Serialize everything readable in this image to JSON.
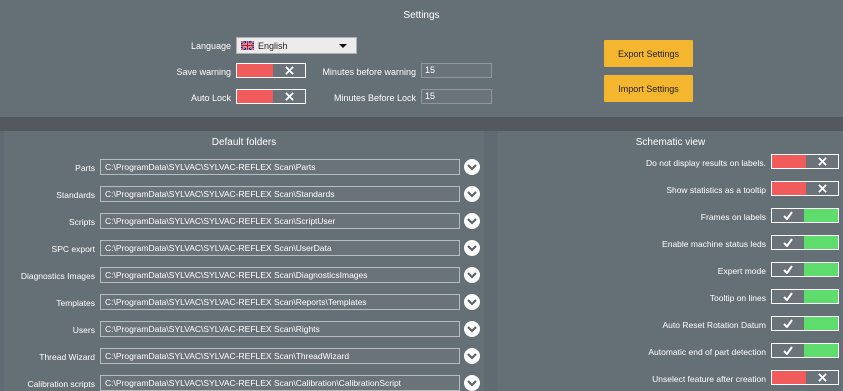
{
  "settings": {
    "title": "Settings",
    "language": {
      "label": "Language",
      "value": "English",
      "flag_icon": "uk-flag-icon"
    },
    "save_warning": {
      "label": "Save warning",
      "state": "off"
    },
    "auto_lock": {
      "label": "Auto Lock",
      "state": "off"
    },
    "minutes_warning": {
      "label": "Minutes before warning",
      "value": "15"
    },
    "minutes_lock": {
      "label": "Minutes Before Lock",
      "value": "15"
    },
    "export_label": "Export Settings",
    "import_label": "Import Settings"
  },
  "folders": {
    "title": "Default folders",
    "items": [
      {
        "label": "Parts",
        "path": "C:\\ProgramData\\SYLVAC\\SYLVAC-REFLEX Scan\\Parts"
      },
      {
        "label": "Standards",
        "path": "C:\\ProgramData\\SYLVAC\\SYLVAC-REFLEX Scan\\Standards"
      },
      {
        "label": "Scripts",
        "path": "C:\\ProgramData\\SYLVAC\\SYLVAC-REFLEX Scan\\ScriptUser"
      },
      {
        "label": "SPC export",
        "path": "C:\\ProgramData\\SYLVAC\\SYLVAC-REFLEX Scan\\UserData"
      },
      {
        "label": "Diagnostics Images",
        "path": "C:\\ProgramData\\SYLVAC\\SYLVAC-REFLEX Scan\\DiagnosticsImages"
      },
      {
        "label": "Templates",
        "path": "C:\\ProgramData\\SYLVAC\\SYLVAC-REFLEX Scan\\Reports\\Templates"
      },
      {
        "label": "Users",
        "path": "C:\\ProgramData\\SYLVAC\\SYLVAC-REFLEX Scan\\Rights"
      },
      {
        "label": "Thread Wizard",
        "path": "C:\\ProgramData\\SYLVAC\\SYLVAC-REFLEX Scan\\ThreadWizard"
      },
      {
        "label": "Calibration scripts",
        "path": "C:\\ProgramData\\SYLVAC\\SYLVAC-REFLEX Scan\\Calibration\\CalibrationScript"
      }
    ]
  },
  "schematic": {
    "title": "Schematic view",
    "items": [
      {
        "label": "Do not display results on labels.",
        "state": "off"
      },
      {
        "label": "Show statistics as a tooltip",
        "state": "off"
      },
      {
        "label": "Frames on labels",
        "state": "on"
      },
      {
        "label": "Enable machine status leds",
        "state": "on"
      },
      {
        "label": "Expert mode",
        "state": "on"
      },
      {
        "label": "Tooltip on lines",
        "state": "on"
      },
      {
        "label": "Auto Reset Rotation Datum",
        "state": "on"
      },
      {
        "label": "Automatic end of part detection",
        "state": "on"
      },
      {
        "label": "Unselect feature after creation",
        "state": "off"
      }
    ]
  },
  "colors": {
    "panel": "#656f76",
    "band": "#52595f",
    "toggle_off": "#f15b5b",
    "toggle_on": "#5fdd6c",
    "accent_button": "#f4b52f"
  }
}
